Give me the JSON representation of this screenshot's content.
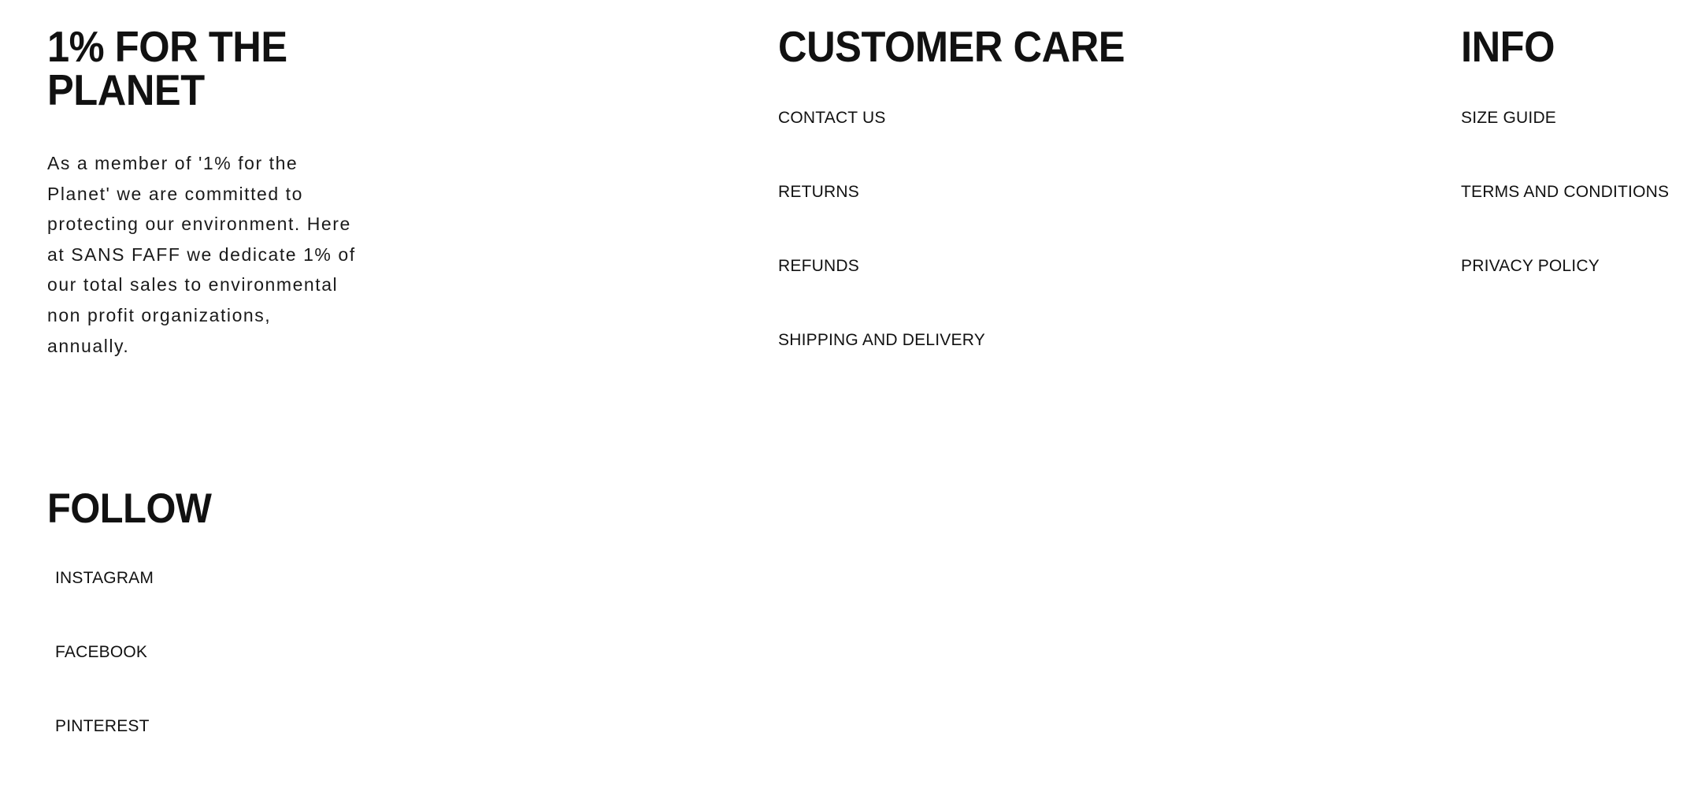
{
  "theme": {
    "background": "#ffffff",
    "text_color": "#111111",
    "body_text_color": "#1a1a1a"
  },
  "planet": {
    "heading": "1% FOR THE\nPLANET",
    "body": "As a member of '1% for the\nPlanet' we are committed to\nprotecting our environment. Here\nat SANS FAFF we dedicate 1% of\nour total sales to environmental\nnon profit organizations,\nannually."
  },
  "follow": {
    "heading": "FOLLOW",
    "links": [
      {
        "label": "INSTAGRAM"
      },
      {
        "label": "FACEBOOK"
      },
      {
        "label": "PINTEREST"
      }
    ]
  },
  "customer_care": {
    "heading": "CUSTOMER CARE",
    "links": [
      {
        "label": "CONTACT US"
      },
      {
        "label": "RETURNS"
      },
      {
        "label": "REFUNDS"
      },
      {
        "label": "SHIPPING AND DELIVERY"
      }
    ]
  },
  "info": {
    "heading": "INFO",
    "links": [
      {
        "label": "SIZE GUIDE"
      },
      {
        "label": "TERMS AND CONDITIONS"
      },
      {
        "label": "PRIVACY POLICY"
      }
    ]
  }
}
